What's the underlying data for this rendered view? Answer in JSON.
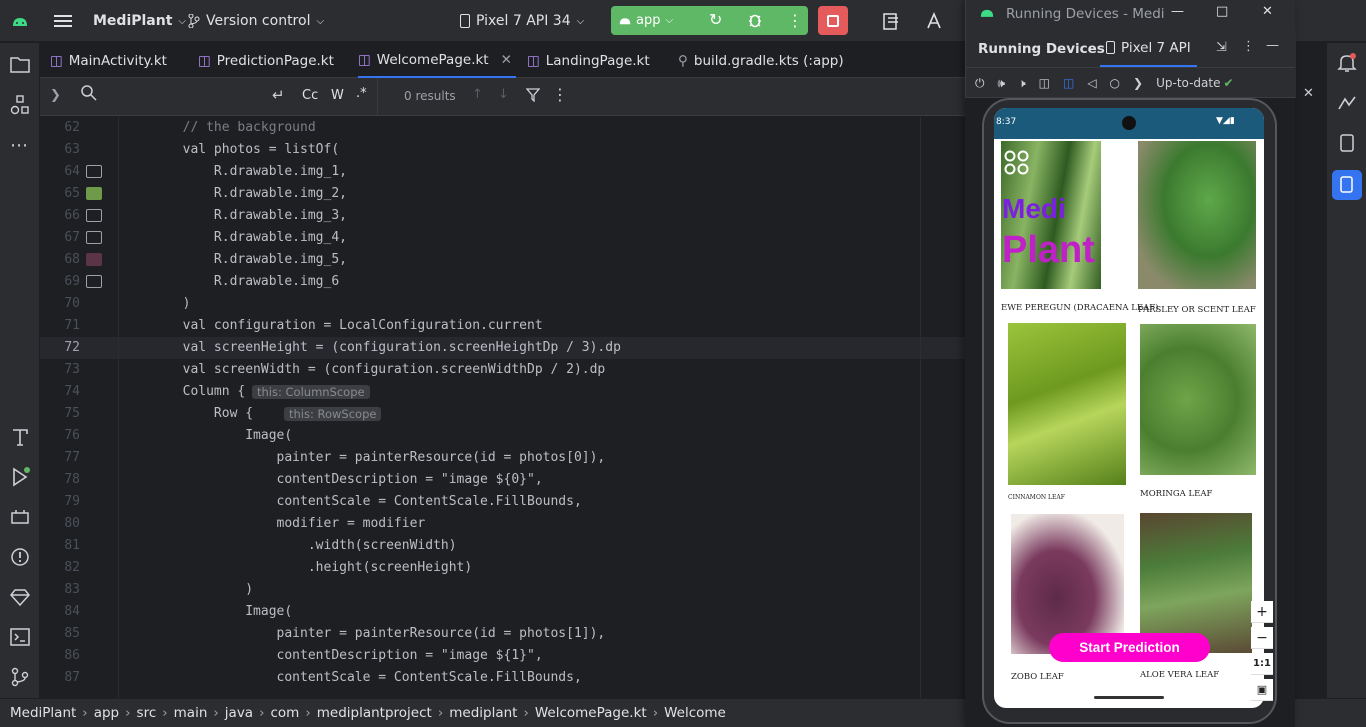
{
  "topbar": {
    "project": "MediPlant",
    "vcs": "Version control",
    "device": "Pixel 7 API 34",
    "run_config": "app"
  },
  "tabs": [
    {
      "label": "MainActivity.kt"
    },
    {
      "label": "PredictionPage.kt"
    },
    {
      "label": "WelcomePage.kt"
    },
    {
      "label": "LandingPage.kt"
    },
    {
      "label": "build.gradle.kts (:app)"
    }
  ],
  "find": {
    "placeholder": "",
    "case": "Cc",
    "word": "W",
    "regex": ".*",
    "results": "0 results"
  },
  "code_lines": [
    {
      "n": "62",
      "text": "        // the background"
    },
    {
      "n": "63",
      "text": "        val photos = listOf("
    },
    {
      "n": "64",
      "text": "            R.drawable.img_1,"
    },
    {
      "n": "65",
      "text": "            R.drawable.img_2,"
    },
    {
      "n": "66",
      "text": "            R.drawable.img_3,"
    },
    {
      "n": "67",
      "text": "            R.drawable.img_4,"
    },
    {
      "n": "68",
      "text": "            R.drawable.img_5,"
    },
    {
      "n": "69",
      "text": "            R.drawable.img_6"
    },
    {
      "n": "70",
      "text": "        )"
    },
    {
      "n": "71",
      "text": "        val configuration = LocalConfiguration.current"
    },
    {
      "n": "72",
      "text": "        val screenHeight = (configuration.screenHeightDp / 3).dp"
    },
    {
      "n": "73",
      "text": "        val screenWidth = (configuration.screenWidthDp / 2).dp"
    },
    {
      "n": "74",
      "text": "        Column {"
    },
    {
      "n": "75",
      "text": "            Row {"
    },
    {
      "n": "76",
      "text": "                Image("
    },
    {
      "n": "77",
      "text": "                    painter = painterResource(id = photos[0]),"
    },
    {
      "n": "78",
      "text": "                    contentDescription = \"image ${0}\","
    },
    {
      "n": "79",
      "text": "                    contentScale = ContentScale.FillBounds,"
    },
    {
      "n": "80",
      "text": "                    modifier = modifier"
    },
    {
      "n": "81",
      "text": "                        .width(screenWidth)"
    },
    {
      "n": "82",
      "text": "                        .height(screenHeight)"
    },
    {
      "n": "83",
      "text": "                )"
    },
    {
      "n": "84",
      "text": "                Image("
    },
    {
      "n": "85",
      "text": "                    painter = painterResource(id = photos[1]),"
    },
    {
      "n": "86",
      "text": "                    contentDescription = \"image ${1}\","
    },
    {
      "n": "87",
      "text": "                    contentScale = ContentScale.FillBounds,"
    }
  ],
  "hints": {
    "column": "this: ColumnScope",
    "row": "this: RowScope"
  },
  "breadcrumbs": [
    "MediPlant",
    "app",
    "src",
    "main",
    "java",
    "com",
    "mediplantproject",
    "mediplant",
    "WelcomePage.kt",
    "Welcome"
  ],
  "running_devices": {
    "window_title": "Running Devices - Medi",
    "panel_title": "Running Devices",
    "device_tab": "Pixel 7 API",
    "status": "Up-to-date"
  },
  "phone": {
    "time": "8:37",
    "logo_line1": "Medi",
    "logo_line2": "Plant",
    "leaves": [
      {
        "label": "EWE PEREGUN (DRACAENA LEAF)"
      },
      {
        "label": "PARSLEY OR SCENT LEAF"
      },
      {
        "label": "CINNAMON LEAF"
      },
      {
        "label": "MORINGA LEAF"
      },
      {
        "label": "ZOBO LEAF"
      },
      {
        "label": "ALOE VERA LEAF"
      }
    ],
    "button": "Start Prediction",
    "zoom_fit": "1:1"
  },
  "colors": {
    "accent": "#3574f0",
    "run_green": "#5fb865",
    "stop_red": "#e55b5b",
    "button_pink": "#ff00cc"
  }
}
